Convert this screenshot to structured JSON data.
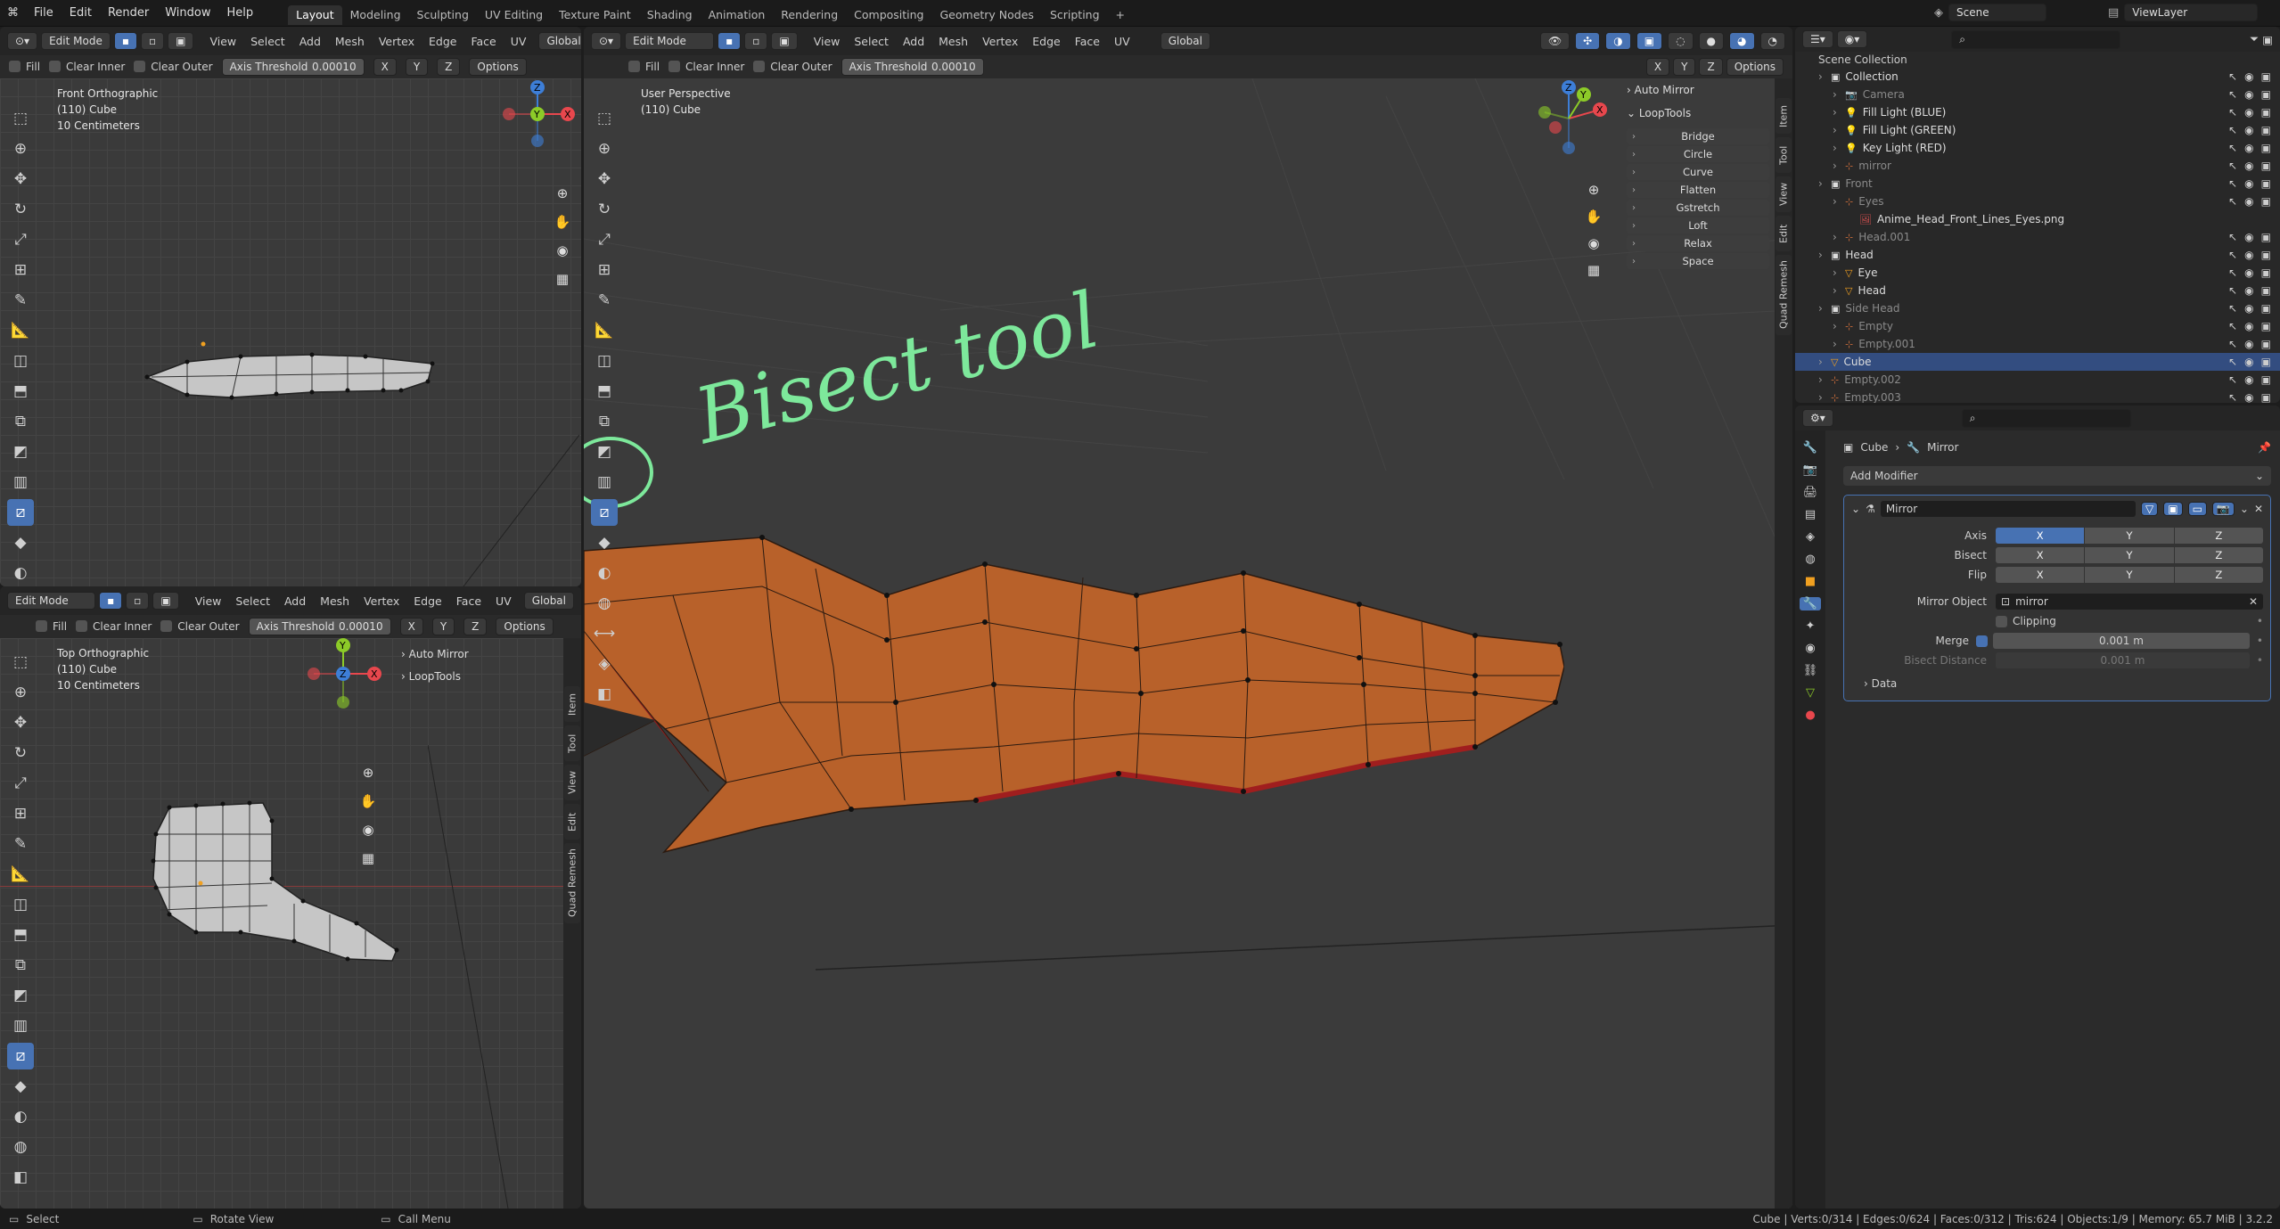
{
  "topbar": {
    "menus": [
      "File",
      "Edit",
      "Render",
      "Window",
      "Help"
    ],
    "workspaces": [
      "Layout",
      "Modeling",
      "Sculpting",
      "UV Editing",
      "Texture Paint",
      "Shading",
      "Animation",
      "Rendering",
      "Compositing",
      "Geometry Nodes",
      "Scripting",
      "+"
    ],
    "active_workspace": "Layout",
    "scene": "Scene",
    "view_layer": "ViewLayer"
  },
  "viewport_header": {
    "mode": "Edit Mode",
    "menus": [
      "View",
      "Select",
      "Add",
      "Mesh",
      "Vertex",
      "Edge",
      "Face",
      "UV"
    ],
    "orientation": "Global",
    "fill": "Fill",
    "clear_inner": "Clear Inner",
    "clear_outer": "Clear Outer",
    "axis_threshold_label": "Axis Threshold",
    "axis_threshold_value": "0.00010",
    "x": "X",
    "y": "Y",
    "z": "Z",
    "options": "Options"
  },
  "viewport_front": {
    "title": "Front Orthographic",
    "object": "(110) Cube",
    "scale": "10 Centimeters"
  },
  "viewport_top": {
    "title": "Top Orthographic",
    "object": "(110) Cube",
    "scale": "10 Centimeters",
    "auto_mirror": "Auto Mirror",
    "looptools": "LoopTools"
  },
  "viewport_persp": {
    "title": "User Perspective",
    "object": "(110) Cube",
    "annotation": "Bisect tool",
    "auto_mirror": "Auto Mirror",
    "looptools": "LoopTools",
    "looptools_items": [
      "Bridge",
      "Circle",
      "Curve",
      "Flatten",
      "Gstretch",
      "Loft",
      "Relax",
      "Space"
    ]
  },
  "sidebar_tabs": [
    "Item",
    "Tool",
    "View",
    "Edit",
    "Quad Remesh"
  ],
  "gizmo": {
    "x": "X",
    "y": "Y",
    "z": "Z"
  },
  "outliner": {
    "root": "Scene Collection",
    "rows": [
      {
        "label": "Collection",
        "indent": 1,
        "type": "collection"
      },
      {
        "label": "Camera",
        "indent": 2,
        "type": "camera",
        "dim": true
      },
      {
        "label": "Fill Light (BLUE)",
        "indent": 2,
        "type": "light"
      },
      {
        "label": "Fill Light (GREEN)",
        "indent": 2,
        "type": "light"
      },
      {
        "label": "Key Light (RED)",
        "indent": 2,
        "type": "light"
      },
      {
        "label": "mirror",
        "indent": 2,
        "type": "empty",
        "dim": true
      },
      {
        "label": "Front",
        "indent": 1,
        "type": "collection",
        "dim": true
      },
      {
        "label": "Eyes",
        "indent": 2,
        "type": "empty",
        "dim": true
      },
      {
        "label": "Anime_Head_Front_Lines_Eyes.png",
        "indent": 3,
        "type": "image"
      },
      {
        "label": "Head.001",
        "indent": 2,
        "type": "empty",
        "dim": true
      },
      {
        "label": "Head",
        "indent": 1,
        "type": "collection"
      },
      {
        "label": "Eye",
        "indent": 2,
        "type": "mesh"
      },
      {
        "label": "Head",
        "indent": 2,
        "type": "mesh"
      },
      {
        "label": "Side Head",
        "indent": 1,
        "type": "collection",
        "dim": true
      },
      {
        "label": "Empty",
        "indent": 2,
        "type": "empty",
        "dim": true
      },
      {
        "label": "Empty.001",
        "indent": 2,
        "type": "empty",
        "dim": true
      },
      {
        "label": "Cube",
        "indent": 1,
        "type": "mesh",
        "selected": true
      },
      {
        "label": "Empty.002",
        "indent": 1,
        "type": "empty",
        "dim": true
      },
      {
        "label": "Empty.003",
        "indent": 1,
        "type": "empty",
        "dim": true
      }
    ]
  },
  "properties": {
    "breadcrumb_object": "Cube",
    "breadcrumb_modifier": "Mirror",
    "add_modifier": "Add Modifier",
    "modifier_name": "Mirror",
    "axis_label": "Axis",
    "bisect_label": "Bisect",
    "flip_label": "Flip",
    "x": "X",
    "y": "Y",
    "z": "Z",
    "mirror_object_label": "Mirror Object",
    "mirror_object_value": "mirror",
    "clipping": "Clipping",
    "merge_label": "Merge",
    "merge_value": "0.001 m",
    "bisect_distance_label": "Bisect Distance",
    "bisect_distance_value": "0.001 m",
    "data": "Data"
  },
  "status": {
    "select": "Select",
    "rotate_view": "Rotate View",
    "call_menu": "Call Menu",
    "stats": "Cube | Verts:0/314 | Edges:0/624 | Faces:0/312 | Tris:624 | Objects:1/9 | Memory: 65.7 MiB | 3.2.2"
  },
  "colors": {
    "accent": "#4772b3",
    "mesh_orange": "#b8612a",
    "annotation_green": "#7de89b",
    "x_axis": "#e8474d",
    "y_axis": "#8ccb28",
    "z_axis": "#3d7ed7"
  }
}
